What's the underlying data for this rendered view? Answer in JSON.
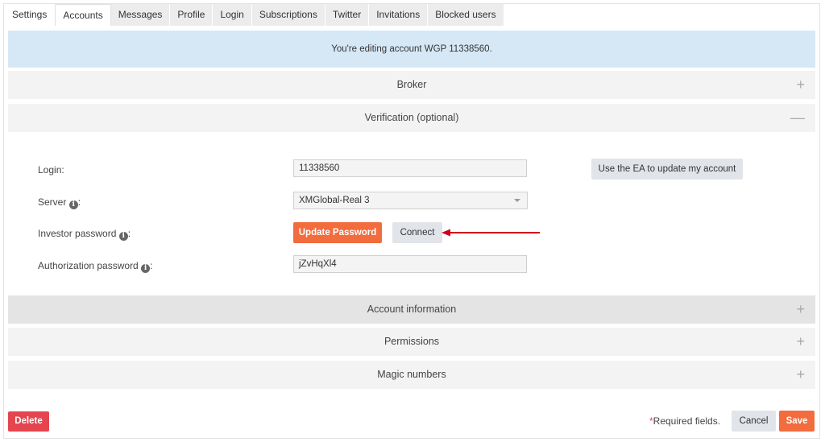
{
  "tabs": [
    "Settings",
    "Accounts",
    "Messages",
    "Profile",
    "Login",
    "Subscriptions",
    "Twitter",
    "Invitations",
    "Blocked users"
  ],
  "active_tab": "Accounts",
  "banner": "You're editing account WGP 11338560.",
  "sections": {
    "broker": {
      "label": "Broker",
      "icon": "plus-icon"
    },
    "verification": {
      "label": "Verification (optional)",
      "icon": "minus-icon"
    },
    "account_information": {
      "label": "Account information",
      "icon": "plus-icon"
    },
    "permissions": {
      "label": "Permissions",
      "icon": "plus-icon"
    },
    "magic_numbers": {
      "label": "Magic numbers",
      "icon": "plus-icon"
    }
  },
  "form": {
    "login_label": "Login:",
    "login_value": "11338560",
    "use_ea_button": "Use the EA to update my account",
    "server_label": "Server",
    "server_suffix": ":",
    "server_value": "XMGlobal-Real 3",
    "investor_label": "Investor password",
    "investor_suffix": ":",
    "update_password_button": "Update Password",
    "connect_button": "Connect",
    "auth_label": "Authorization password",
    "auth_suffix": ":",
    "auth_value": "jZvHqXl4"
  },
  "footer": {
    "delete_button": "Delete",
    "required_star": "*",
    "required_text": "Required fields.",
    "cancel_button": "Cancel",
    "save_button": "Save"
  },
  "colors": {
    "accent_orange": "#f26c3d",
    "danger_red": "#e5454f",
    "banner_blue": "#d6e8f6",
    "arrow_red": "#d0021b"
  }
}
